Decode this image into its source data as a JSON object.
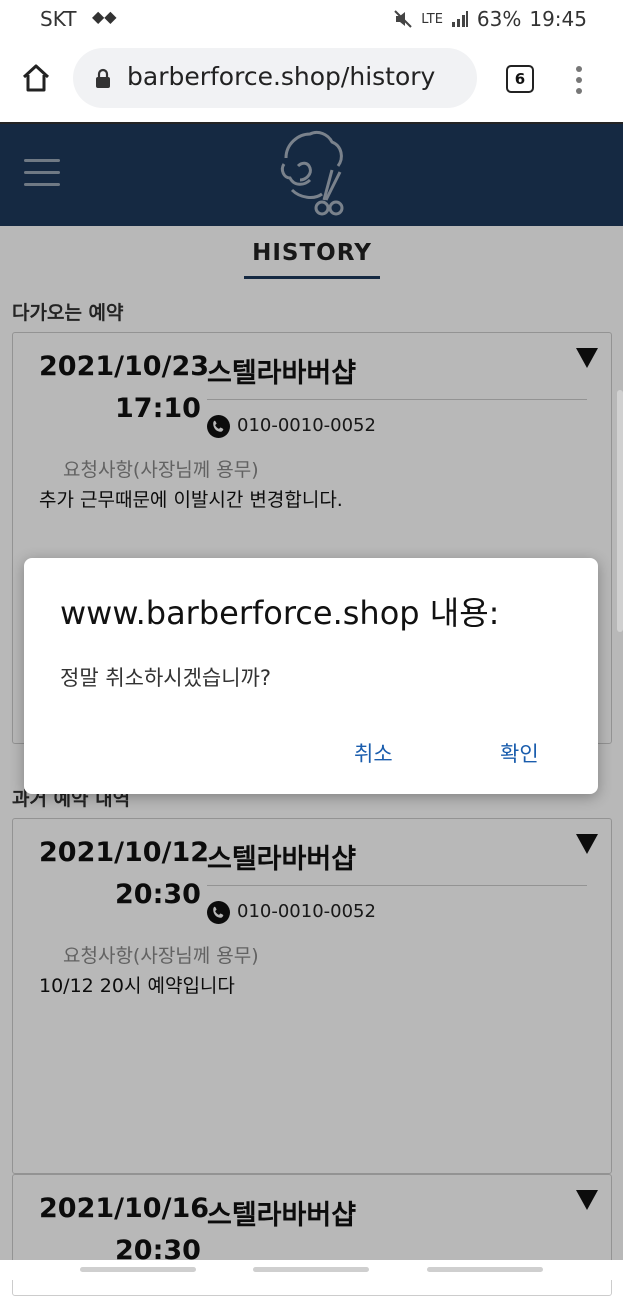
{
  "status_bar": {
    "carrier": "SKT",
    "lte": "LTE",
    "battery": "63%",
    "time": "19:45"
  },
  "browser": {
    "url": "barberforce.shop/history",
    "tab_count": "6"
  },
  "page": {
    "tab_label": "HISTORY",
    "upcoming_section": "다가오는 예약",
    "past_section": "과거 예약 내역",
    "request_label": "요청사항(사장님께 용무)"
  },
  "cards": [
    {
      "date": "2021/10/23",
      "time": "17:10",
      "shop": "스텔라바버샵",
      "phone": "010-0010-0052",
      "request": "추가 근무때문에 이발시간 변경합니다."
    },
    {
      "date": "2021/10/12",
      "time": "20:30",
      "shop": "스텔라바버샵",
      "phone": "010-0010-0052",
      "request": "10/12 20시 예약입니다"
    },
    {
      "date": "2021/10/16",
      "time": "20:30",
      "shop": "스텔라바버샵"
    }
  ],
  "dialog": {
    "title": "www.barberforce.shop 내용:",
    "message": "정말 취소하시겠습니까?",
    "cancel_label": "취소",
    "ok_label": "확인"
  },
  "colors": {
    "header_bg": "#1e3a5c",
    "dialog_button": "#1a5dad"
  }
}
